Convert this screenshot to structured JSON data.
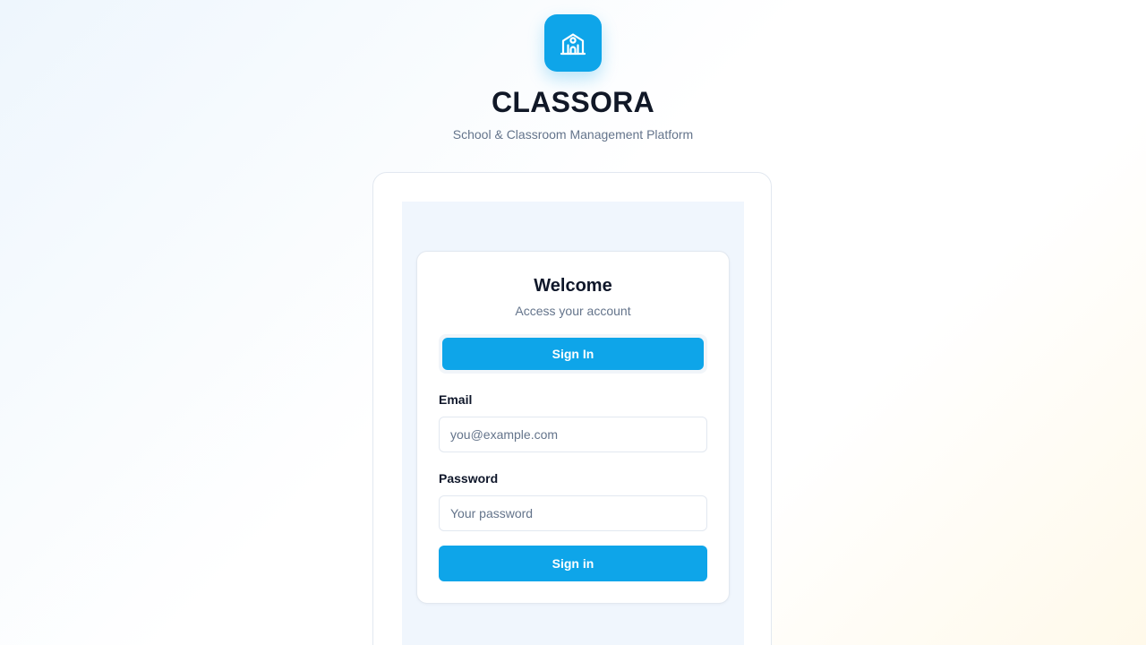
{
  "brand": {
    "title": "CLASSORA",
    "subtitle": "School & Classroom Management Platform",
    "logo_icon": "school-building-icon",
    "accent_color": "#0ea5e9"
  },
  "auth": {
    "heading": "Welcome",
    "subheading": "Access your account",
    "tabs": [
      {
        "label": "Sign In",
        "active": true
      }
    ],
    "fields": {
      "email": {
        "label": "Email",
        "value": "",
        "placeholder": "you@example.com"
      },
      "password": {
        "label": "Password",
        "value": "",
        "placeholder": "Your password"
      }
    },
    "submit_label": "Sign in"
  }
}
